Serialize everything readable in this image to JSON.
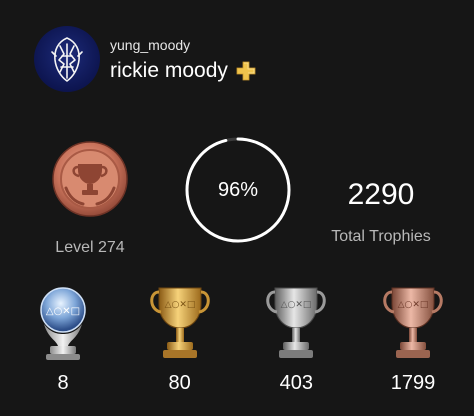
{
  "profile": {
    "online_id": "yung_moody",
    "real_name": "rickie moody",
    "avatar_icon": "avatar-icon",
    "plus_icon": "ps-plus-icon",
    "plus_color": "#f0c44c"
  },
  "level": {
    "label": "Level 274",
    "medal_icon": "level-trophy-medal-icon",
    "medal_color": "#c8725a"
  },
  "progress": {
    "label": "96%",
    "value": 0.96
  },
  "total": {
    "value": "2290",
    "label": "Total Trophies"
  },
  "trophies": [
    {
      "type": "platinum",
      "icon": "platinum-trophy-icon",
      "count": "8",
      "color": "#b9d0ee"
    },
    {
      "type": "gold",
      "icon": "gold-trophy-icon",
      "count": "80",
      "color": "#d9a441"
    },
    {
      "type": "silver",
      "icon": "silver-trophy-icon",
      "count": "403",
      "color": "#b4b4b4"
    },
    {
      "type": "bronze",
      "icon": "bronze-trophy-icon",
      "count": "1799",
      "color": "#c98a76"
    }
  ]
}
